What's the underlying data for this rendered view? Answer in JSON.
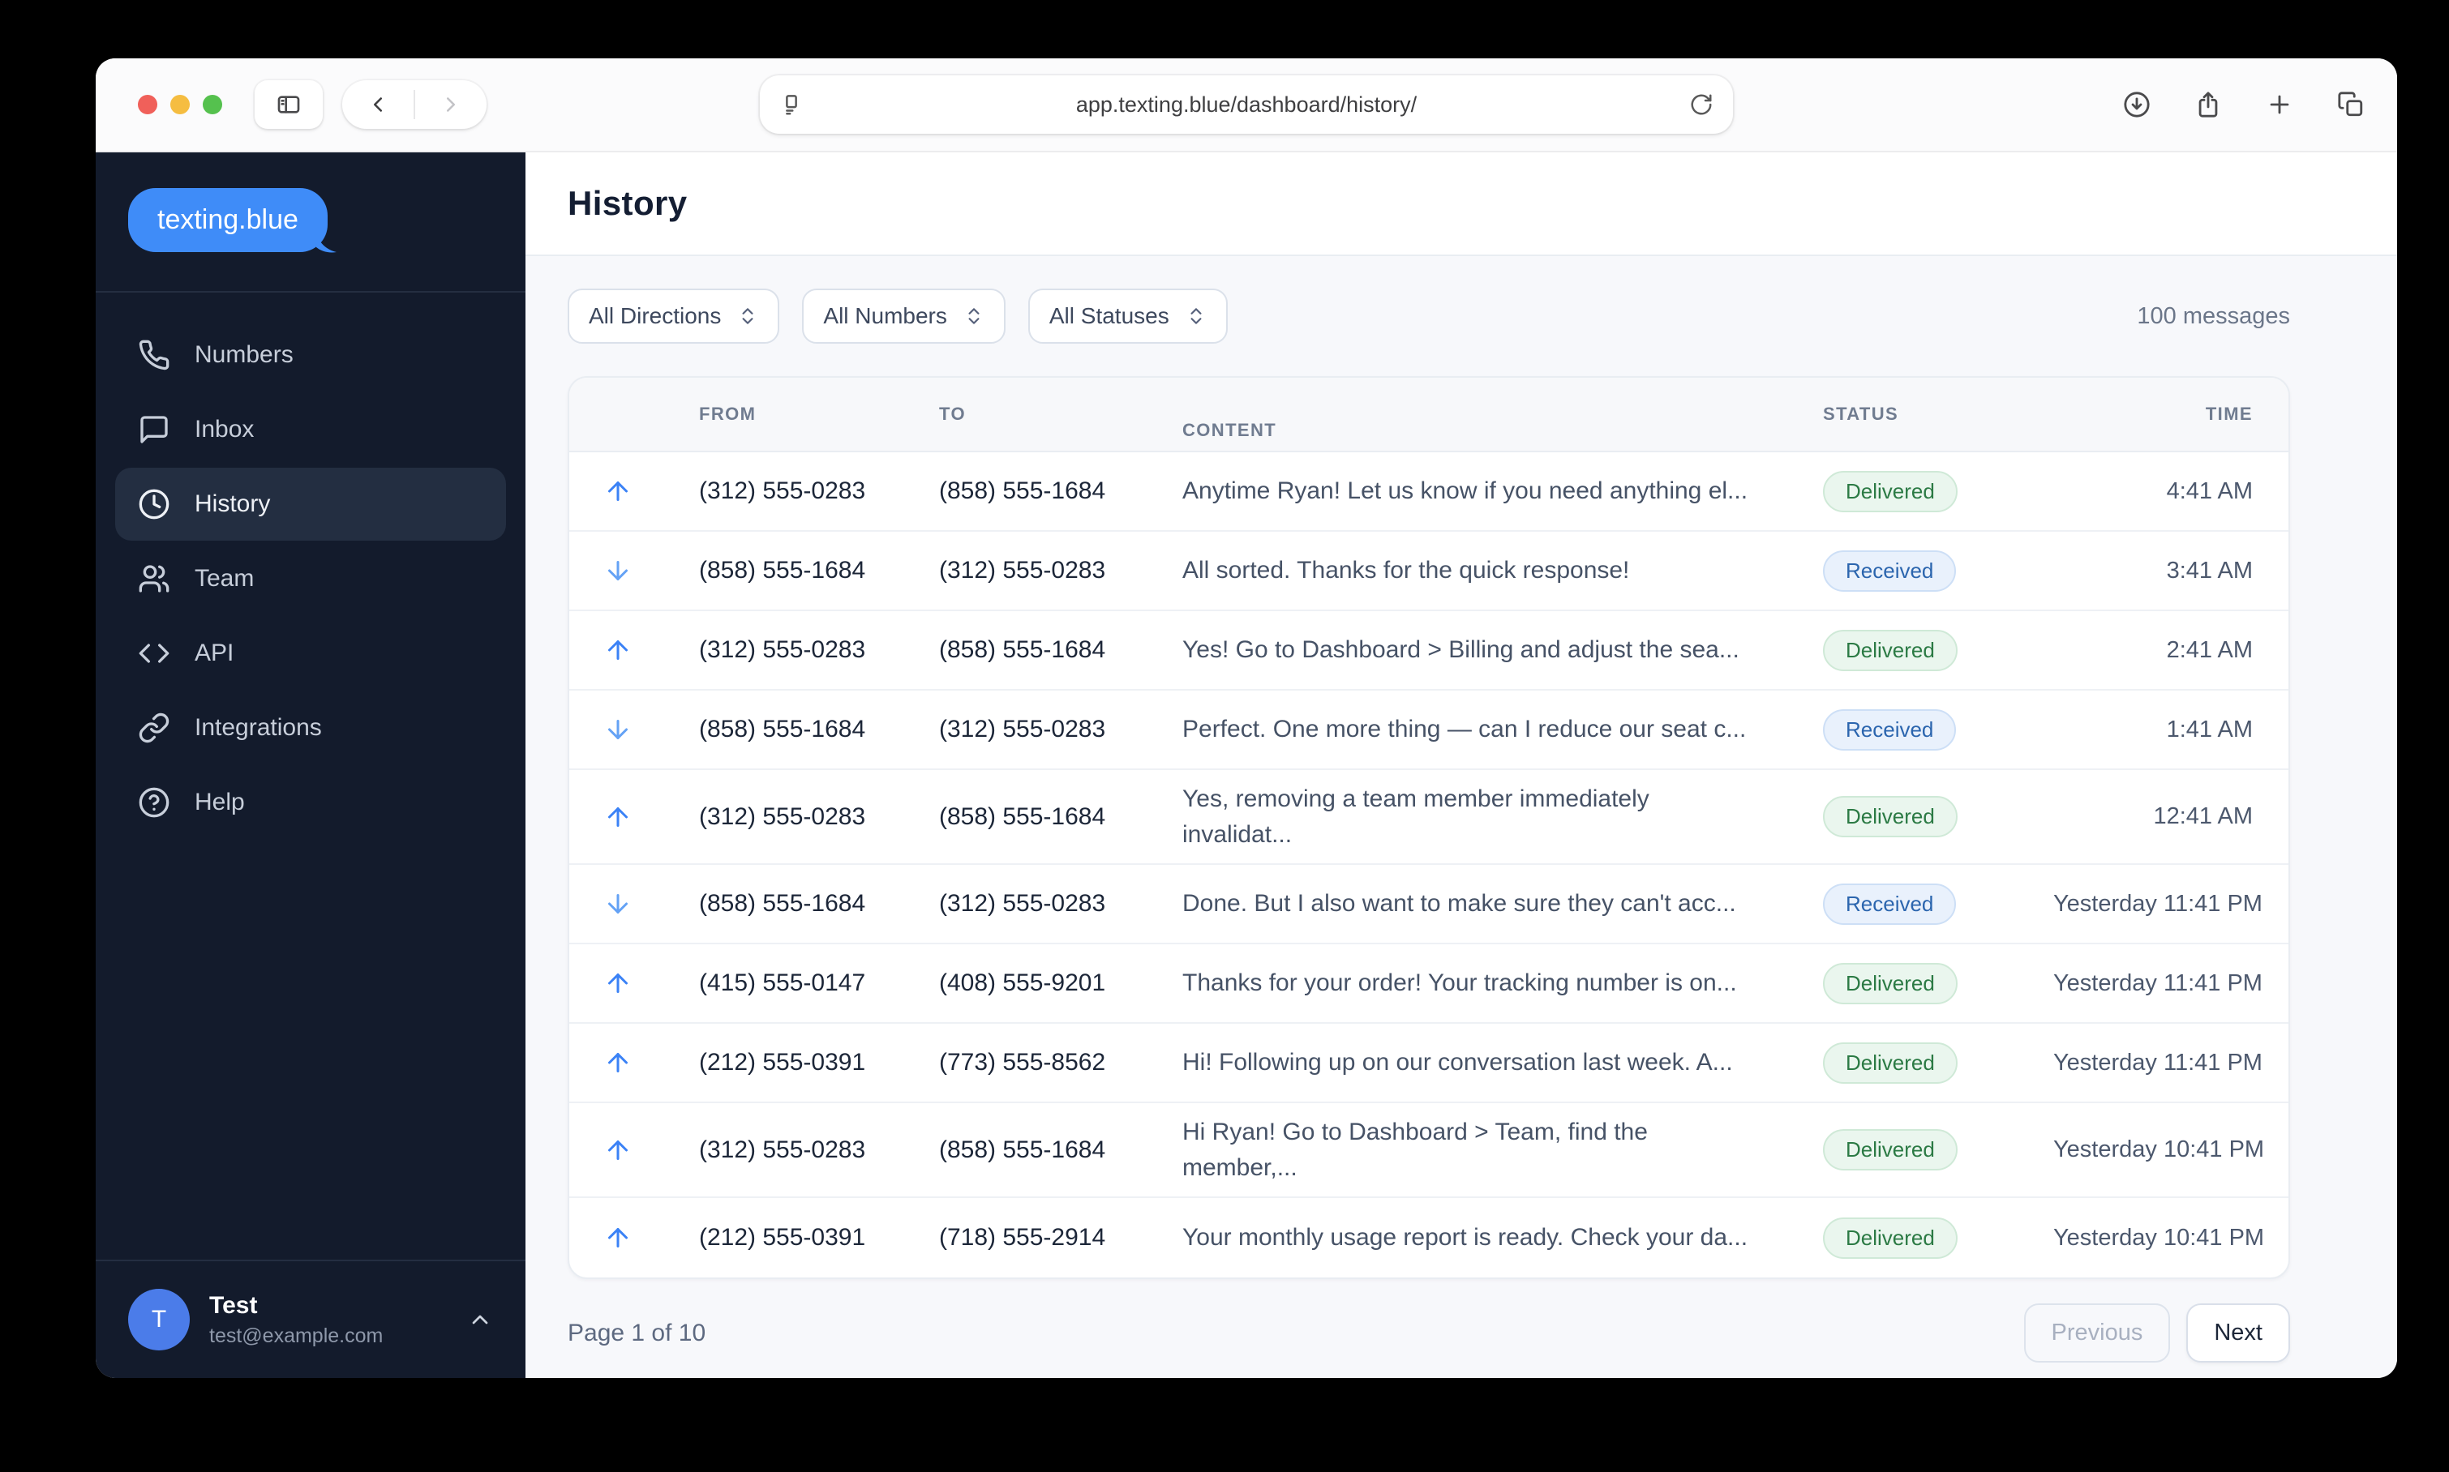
{
  "colors": {
    "brand_blue": "#3f8cf8",
    "sidebar_bg": "#131b2c",
    "sidebar_active_bg": "#232e41",
    "traffic_red": "#f0605a",
    "traffic_yellow": "#f5bd41",
    "traffic_green": "#55c14e",
    "arrow_out_blue": "#3b82f6",
    "arrow_in_blue": "#64a2f5",
    "delivered_text": "#2b7a44",
    "delivered_bg": "#eaf6ee",
    "delivered_border": "#cfe9d7",
    "received_text": "#2b65ae",
    "received_bg": "#e9f1fc",
    "received_border": "#cddff6"
  },
  "browser": {
    "url": "app.texting.blue/dashboard/history/",
    "window_controls": [
      "close-button",
      "minimize-button",
      "maximize-button"
    ],
    "toolbar_left_icons": [
      "sidebar-toggle-icon",
      "back-icon",
      "forward-icon"
    ],
    "url_bar_icons": [
      "reader-icon",
      "refresh-icon"
    ],
    "toolbar_right_icons": [
      "download-icon",
      "share-icon",
      "new-tab-icon",
      "tabs-icon"
    ]
  },
  "sidebar": {
    "logo_text": "texting.blue",
    "items": [
      {
        "label": "Numbers",
        "icon": "phone-icon",
        "name": "sidebar-item-numbers",
        "state": ""
      },
      {
        "label": "Inbox",
        "icon": "message-square-icon",
        "name": "sidebar-item-inbox",
        "state": ""
      },
      {
        "label": "History",
        "icon": "clock-icon",
        "name": "sidebar-item-history",
        "state": "active"
      },
      {
        "label": "Team",
        "icon": "users-icon",
        "name": "sidebar-item-team",
        "state": ""
      },
      {
        "label": "API",
        "icon": "code-icon",
        "name": "sidebar-item-api",
        "state": ""
      },
      {
        "label": "Integrations",
        "icon": "link-icon",
        "name": "sidebar-item-integrations",
        "state": ""
      },
      {
        "label": "Help",
        "icon": "help-icon",
        "name": "sidebar-item-help",
        "state": ""
      }
    ],
    "user": {
      "initial": "T",
      "name": "Test",
      "email": "test@example.com",
      "chevron_icon": "chevron-up-icon"
    }
  },
  "main": {
    "title": "History",
    "filters": [
      {
        "label": "All Directions",
        "name": "filter-directions",
        "icon": "chevrons-up-down-icon"
      },
      {
        "label": "All Numbers",
        "name": "filter-numbers",
        "icon": "chevrons-up-down-icon"
      },
      {
        "label": "All Statuses",
        "name": "filter-statuses",
        "icon": "chevrons-up-down-icon"
      }
    ],
    "messages_count": "100 messages",
    "table": {
      "headers": [
        {
          "label": "FROM"
        },
        {
          "label": "TO"
        },
        {
          "label": "CONTENT"
        },
        {
          "label": "STATUS"
        },
        {
          "label": "TIME"
        }
      ],
      "rows": [
        {
          "direction": "outbound",
          "from": "(312) 555-0283",
          "to": "(858) 555-1684",
          "content": "Anytime Ryan! Let us know if you need anything el...",
          "status": "Delivered",
          "time": "4:41 AM"
        },
        {
          "direction": "inbound",
          "from": "(858) 555-1684",
          "to": "(312) 555-0283",
          "content": "All sorted. Thanks for the quick response!",
          "status": "Received",
          "time": "3:41 AM"
        },
        {
          "direction": "outbound",
          "from": "(312) 555-0283",
          "to": "(858) 555-1684",
          "content": "Yes! Go to Dashboard > Billing and adjust the sea...",
          "status": "Delivered",
          "time": "2:41 AM"
        },
        {
          "direction": "inbound",
          "from": "(858) 555-1684",
          "to": "(312) 555-0283",
          "content": "Perfect. One more thing — can I reduce our seat c...",
          "status": "Received",
          "time": "1:41 AM"
        },
        {
          "direction": "outbound",
          "from": "(312) 555-0283",
          "to": "(858) 555-1684",
          "content": "Yes, removing a team member immediately invalidat...",
          "status": "Delivered",
          "time": "12:41 AM"
        },
        {
          "direction": "inbound",
          "from": "(858) 555-1684",
          "to": "(312) 555-0283",
          "content": "Done. But I also want to make sure they can't acc...",
          "status": "Received",
          "time": "Yesterday 11:41 PM"
        },
        {
          "direction": "outbound",
          "from": "(415) 555-0147",
          "to": "(408) 555-9201",
          "content": "Thanks for your order! Your tracking number is on...",
          "status": "Delivered",
          "time": "Yesterday 11:41 PM"
        },
        {
          "direction": "outbound",
          "from": "(212) 555-0391",
          "to": "(773) 555-8562",
          "content": "Hi! Following up on our conversation last week. A...",
          "status": "Delivered",
          "time": "Yesterday 11:41 PM"
        },
        {
          "direction": "outbound",
          "from": "(312) 555-0283",
          "to": "(858) 555-1684",
          "content": "Hi Ryan! Go to Dashboard > Team, find the member,...",
          "status": "Delivered",
          "time": "Yesterday 10:41 PM",
          "display": "two-line"
        },
        {
          "direction": "outbound",
          "from": "(212) 555-0391",
          "to": "(718) 555-2914",
          "content": "Your monthly usage report is ready. Check your da...",
          "status": "Delivered",
          "time": "Yesterday 10:41 PM"
        }
      ]
    },
    "pagination": {
      "page_label": "Page 1 of 10",
      "previous_label": "Previous",
      "next_label": "Next"
    }
  }
}
